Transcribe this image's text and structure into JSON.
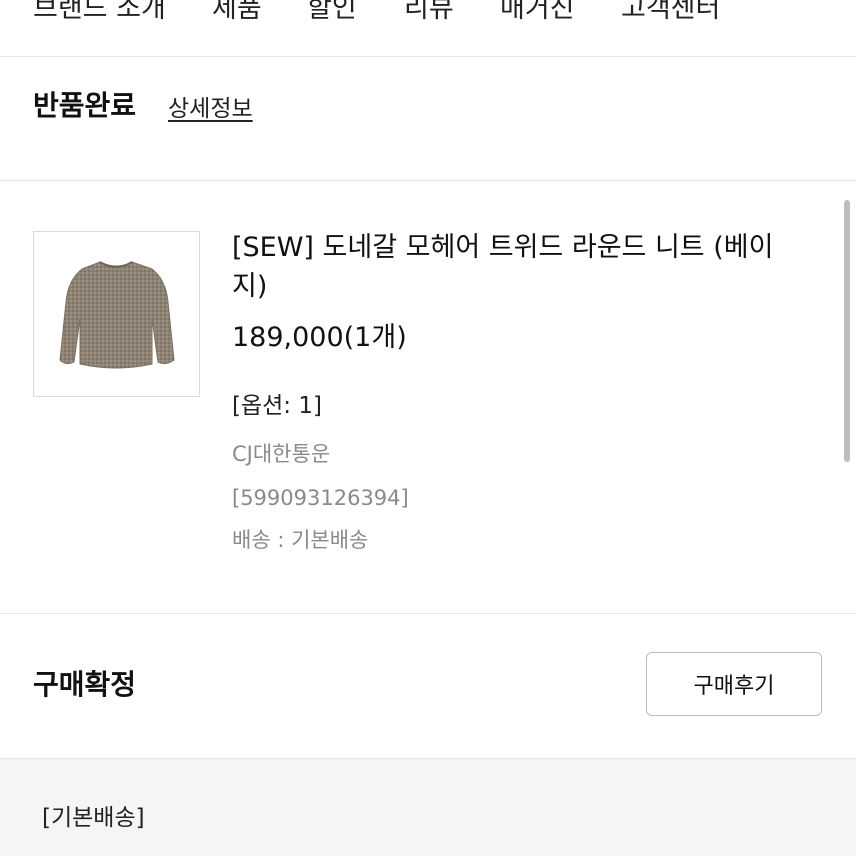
{
  "nav": {
    "items": [
      "브랜드 소개",
      "제품",
      "할인",
      "리뷰",
      "매거진",
      "고객센터"
    ]
  },
  "order": {
    "status": "반품완료",
    "detail_link": "상세정보"
  },
  "product": {
    "name": "[SEW] 도네갈 모헤어 트위드 라운드 니트 (베이지)",
    "price": "189,000(1개)",
    "option": "[옵션: 1]",
    "courier": "CJ대한통운",
    "tracking": "[599093126394]",
    "shipping": "배송 : 기본배송",
    "thumbnail_icon": "knit-sweater-image"
  },
  "confirm": {
    "label": "구매확정",
    "review_button": "구매후기"
  },
  "delivery": {
    "label": "[기본배송]"
  },
  "colors": {
    "sweater": "#8d8273",
    "divider": "#e4e4e4",
    "muted_text": "#8a8a8a",
    "section_bg": "#f5f5f5"
  }
}
